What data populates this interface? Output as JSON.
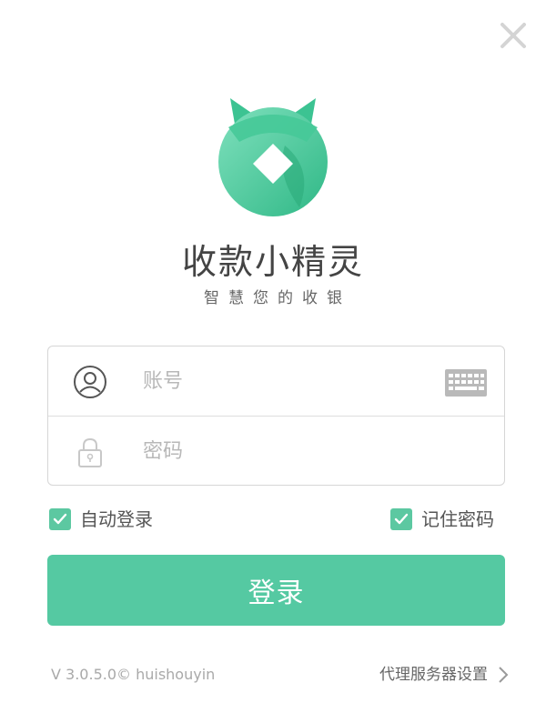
{
  "window": {
    "close_icon": "close-icon"
  },
  "brand": {
    "logo_icon": "app-logo-icon",
    "title": "收款小精灵",
    "slogan": "智慧您的收银",
    "colors": {
      "primary": "#55c9a2",
      "logo_light": "#7fe0bd",
      "logo_dark": "#2fb886"
    }
  },
  "form": {
    "account": {
      "icon": "user-icon",
      "placeholder": "账号",
      "value": "",
      "keyboard_icon": "keyboard-icon"
    },
    "password": {
      "icon": "lock-icon",
      "placeholder": "密码",
      "value": ""
    },
    "auto_login": {
      "label": "自动登录",
      "checked": true
    },
    "remember_password": {
      "label": "记住密码",
      "checked": true
    },
    "login_button": "登录"
  },
  "footer": {
    "version": "V 3.0.5.0© huishouyin",
    "proxy_settings": "代理服务器设置",
    "chevron_icon": "chevron-right-icon"
  }
}
